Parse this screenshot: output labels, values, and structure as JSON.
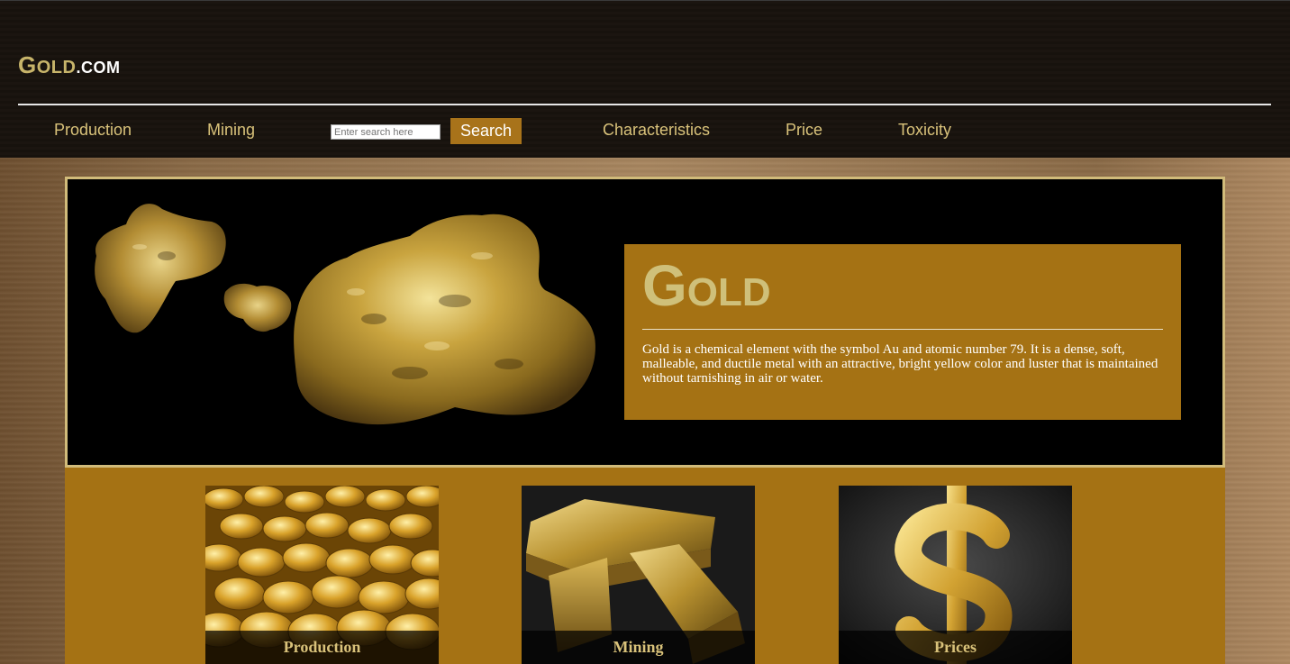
{
  "header": {
    "logo": {
      "g": "G",
      "rest": "OLD",
      "com": ".COM"
    },
    "nav": [
      {
        "label": "Production"
      },
      {
        "label": "Mining"
      },
      {
        "label": "Characteristics"
      },
      {
        "label": "Price"
      },
      {
        "label": "Toxicity"
      }
    ],
    "search": {
      "placeholder": "Enter search here",
      "button_label": "Search"
    }
  },
  "hero": {
    "title_first": "G",
    "title_rest": "OLD",
    "description": "Gold is a chemical element with the symbol Au and atomic number 79. It is a dense, soft, malleable, and ductile metal with an attractive, bright yellow color and luster that is maintained without tarnishing in air or water."
  },
  "cards": [
    {
      "label": "Production"
    },
    {
      "label": "Mining"
    },
    {
      "label": "Prices"
    }
  ],
  "colors": {
    "header_bg": "#1b1510",
    "nav_text": "#d9c27a",
    "accent_gold": "#a57214",
    "hero_border": "#d1bb7a"
  }
}
